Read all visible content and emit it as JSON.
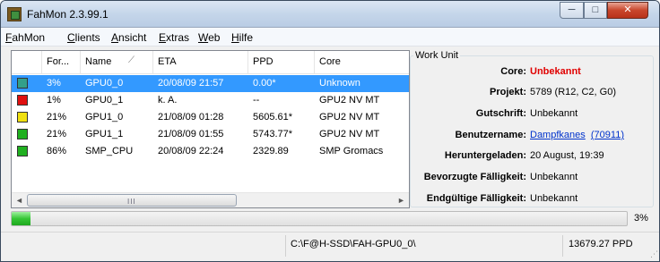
{
  "window": {
    "title": "FahMon 2.3.99.1",
    "minimize": "─",
    "maximize": "□",
    "close": "✕"
  },
  "menu": [
    {
      "mnemonic": "F",
      "rest": "ahMon"
    },
    {
      "mnemonic": "C",
      "rest": "lients"
    },
    {
      "mnemonic": "A",
      "rest": "nsicht"
    },
    {
      "mnemonic": "E",
      "rest": "xtras"
    },
    {
      "mnemonic": "W",
      "rest": "eb"
    },
    {
      "mnemonic": "H",
      "rest": "ilfe"
    }
  ],
  "list": {
    "columns": [
      "For...",
      "Name",
      "ETA",
      "PPD",
      "Core"
    ],
    "rows": [
      {
        "status": "#33a08a",
        "progress": "3%",
        "name": "GPU0_0",
        "eta": "20/08/09  21:57",
        "ppd": "0.00*",
        "core": "Unknown"
      },
      {
        "status": "#e01010",
        "progress": "1%",
        "name": "GPU0_1",
        "eta": "k. A.",
        "ppd": "--",
        "core": "GPU2 NV MT"
      },
      {
        "status": "#f0e010",
        "progress": "21%",
        "name": "GPU1_0",
        "eta": "21/08/09  01:28",
        "ppd": "5605.61*",
        "core": "GPU2 NV MT"
      },
      {
        "status": "#20b020",
        "progress": "21%",
        "name": "GPU1_1",
        "eta": "21/08/09  01:55",
        "ppd": "5743.77*",
        "core": "GPU2 NV MT"
      },
      {
        "status": "#20b020",
        "progress": "86%",
        "name": "SMP_CPU",
        "eta": "20/08/09  22:24",
        "ppd": "2329.89",
        "core": "SMP Gromacs"
      }
    ],
    "selected_row": 0,
    "scroll": {
      "left": "◄",
      "right": "►",
      "grip": "III"
    }
  },
  "work_unit": {
    "legend": "Work Unit",
    "core_label": "Core:",
    "core_value": "Unbekannt",
    "project_label": "Projekt:",
    "project_value": "5789 (R12, C2, G0)",
    "credit_label": "Gutschrift:",
    "credit_value": "Unbekannt",
    "user_label": "Benutzername:",
    "user_name": "Dampfkanes",
    "user_team": "(70911)",
    "downloaded_label": "Heruntergeladen:",
    "downloaded_value": "20 August, 19:39",
    "preferred_label": "Bevorzugte Fälligkeit:",
    "preferred_value": "Unbekannt",
    "final_label": "Endgültige Fälligkeit:",
    "final_value": "Unbekannt"
  },
  "progress": {
    "value_fraction": 0.03,
    "label": "3%"
  },
  "statusbar": {
    "path": "C:\\F@H-SSD\\FAH-GPU0_0\\",
    "ppd": "13679.27 PPD"
  }
}
